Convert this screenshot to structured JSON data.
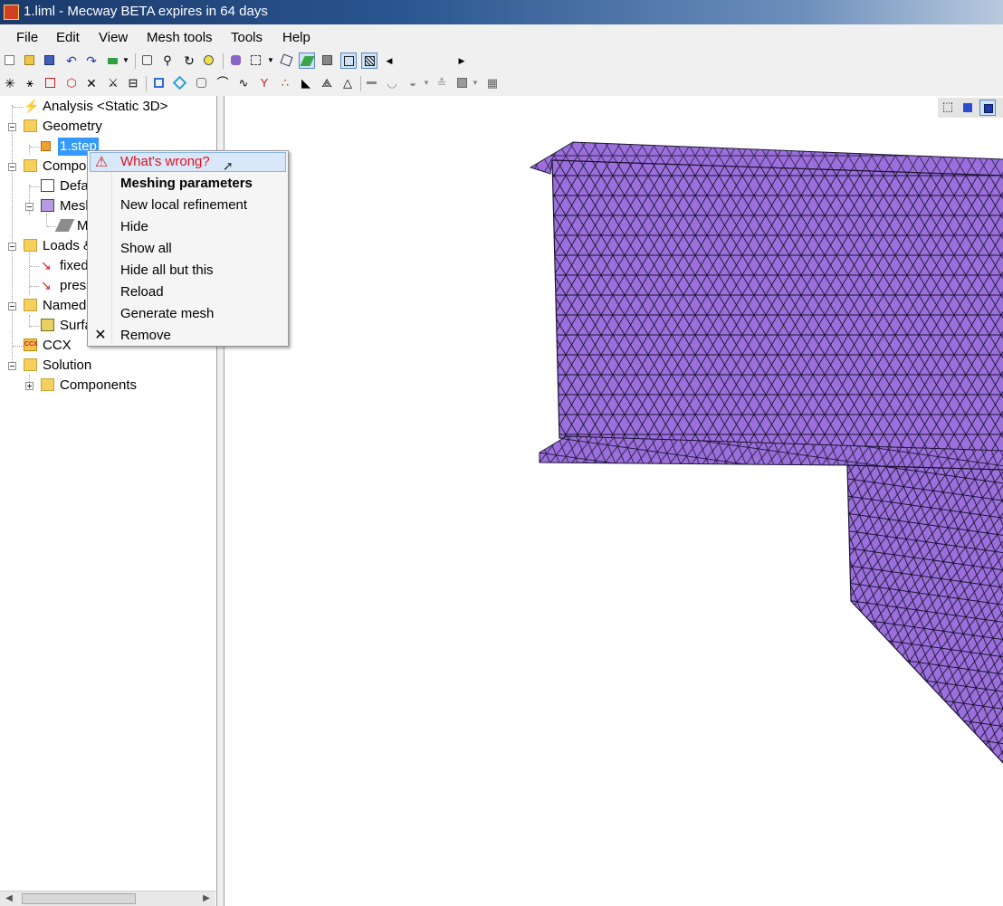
{
  "window": {
    "title": "1.liml - Mecway BETA expires in 64 days"
  },
  "menu": [
    "File",
    "Edit",
    "View",
    "Mesh tools",
    "Tools",
    "Help"
  ],
  "tree": {
    "analysis": "Analysis <Static 3D>",
    "geometry": "Geometry",
    "geometry_item": "1.step",
    "components": "Compon",
    "default": "Defa",
    "mesh": "Mesh",
    "mesh_child": "M",
    "loads": "Loads &",
    "fixed": "fixed",
    "pressure": "press",
    "named": "Named",
    "surface": "Surfa",
    "ccx": "CCX",
    "ccx_icon_text": "CCX",
    "solution": "Solution",
    "solution_components": "Components"
  },
  "context_menu": {
    "items": [
      "What's wrong?",
      "Meshing parameters",
      "New local refinement",
      "Hide",
      "Show all",
      "Hide all but this",
      "Reload",
      "Generate mesh",
      "Remove"
    ],
    "highlighted_index": 0,
    "bold_index": 1
  },
  "colors": {
    "mesh_fill": "#9b6fdc",
    "mesh_lines": "#1b1430",
    "selection": "#3399ff",
    "warning_text": "#e01020"
  }
}
